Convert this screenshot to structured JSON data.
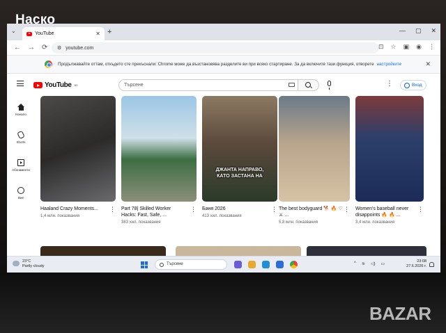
{
  "overlay_branding": {
    "seller_logo": "Наско",
    "marketplace_logo": "BAZAR"
  },
  "browser": {
    "tab_title": "YouTube",
    "url": "youtube.com",
    "infobar_text": "Продължавайте оттам, откъдето сте прекъснали: Chrome може да възстановява разделите ви при всяко стартиране. За да включите тази функция, отворете",
    "infobar_link": "настройките"
  },
  "youtube": {
    "logo_text": "YouTube",
    "logo_region": "BG",
    "search_placeholder": "Търсене",
    "signin_label": "Вход",
    "sidebar": [
      {
        "label": "Начало",
        "icon": "home-icon"
      },
      {
        "label": "Shorts",
        "icon": "shorts-icon"
      },
      {
        "label": "Абонаменти",
        "icon": "subscriptions-icon"
      },
      {
        "label": "Вие",
        "icon": "you-icon"
      }
    ],
    "videos": [
      {
        "title": "Haaland Crazy Moments...",
        "meta": "1,4 млн. показвания",
        "overlay": ""
      },
      {
        "title": "Part 78| Skilled Worker Hacks: Fast, Safe, ...",
        "meta": "383 хил. показвания",
        "overlay": ""
      },
      {
        "title": "Баня 2026",
        "meta": "413 хил. показвания",
        "overlay": "ДЖАНТА НАПРАВО, КАТО ЗАСТАНА НА"
      },
      {
        "title": "The best bodyguard 🐕 🔥 ♡ ⚔ ...",
        "meta": "5,8 млн. показвания",
        "overlay": ""
      },
      {
        "title": "Women's baseball never disappoints 🔥 🔥 ...",
        "meta": "3,4 млн. показвания",
        "overlay": ""
      }
    ]
  },
  "taskbar": {
    "weather_temp": "23°C",
    "weather_desc": "Partly cloudy",
    "search_placeholder": "Търсене",
    "time": "23:08",
    "date": "27.6.2026 г."
  }
}
